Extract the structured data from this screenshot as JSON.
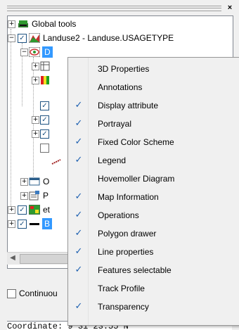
{
  "panel": {
    "close_label": "×"
  },
  "tree": {
    "global_tools": "Global tools",
    "landuse": "Landuse2 - Landuse.USAGETYPE",
    "display_partial": "D",
    "item_o": "O",
    "item_p": "P",
    "item_et": "et",
    "item_b": "B"
  },
  "checkbox": {
    "continuous_label": "Continuou"
  },
  "coord": {
    "text": "Coordinate:  9°31'23.55\"N"
  },
  "menu": {
    "items": [
      {
        "label": "3D Properties",
        "checked": false
      },
      {
        "label": "Annotations",
        "checked": false
      },
      {
        "label": "Display attribute",
        "checked": true
      },
      {
        "label": "Portrayal",
        "checked": true
      },
      {
        "label": "Fixed Color Scheme",
        "checked": true
      },
      {
        "label": "Legend",
        "checked": true
      },
      {
        "label": "Hovemoller Diagram",
        "checked": false
      },
      {
        "label": "Map Information",
        "checked": true
      },
      {
        "label": "Operations",
        "checked": true
      },
      {
        "label": "Polygon drawer",
        "checked": true
      },
      {
        "label": "Line properties",
        "checked": true
      },
      {
        "label": "Features selectable",
        "checked": true
      },
      {
        "label": "Track Profile",
        "checked": false
      },
      {
        "label": "Transparency",
        "checked": true
      }
    ],
    "check_glyph": "✓"
  },
  "colors": {
    "check": "#1c5fb0",
    "selection": "#3399ff"
  },
  "icons": {
    "expand": "plus-icon",
    "collapse": "minus-icon"
  }
}
